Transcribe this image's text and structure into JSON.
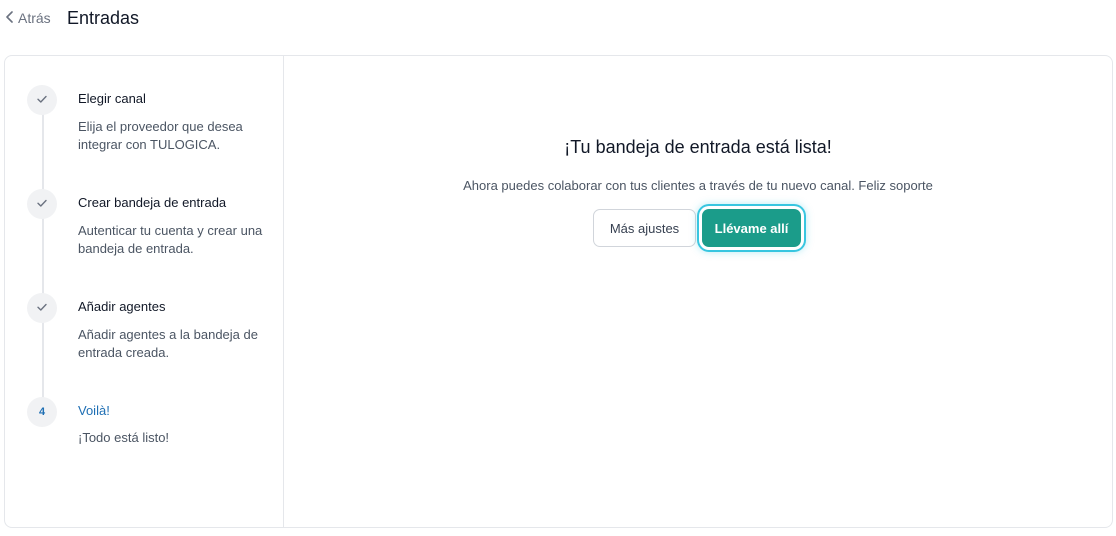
{
  "header": {
    "back_label": "Atrás",
    "title": "Entradas"
  },
  "steps": [
    {
      "marker": "check",
      "title": "Elegir canal",
      "description": "Elija el proveedor que desea integrar con TULOGICA."
    },
    {
      "marker": "check",
      "title": "Crear bandeja de entrada",
      "description": "Autenticar tu cuenta y crear una bandeja de entrada."
    },
    {
      "marker": "check",
      "title": "Añadir agentes",
      "description": "Añadir agentes a la bandeja de entrada creada."
    },
    {
      "marker": "4",
      "title": "Voilà!",
      "description": "¡Todo está listo!"
    }
  ],
  "main": {
    "headline": "¡Tu bandeja de entrada está lista!",
    "subline": "Ahora puedes colaborar con tus clientes a través de tu nuevo canal. Feliz soporte",
    "secondary_button": "Más ajustes",
    "primary_button": "Llévame allí"
  },
  "colors": {
    "accent": "#1b9c8a",
    "active_step": "#1f6fb4",
    "focus_ring": "#38c6e0"
  }
}
